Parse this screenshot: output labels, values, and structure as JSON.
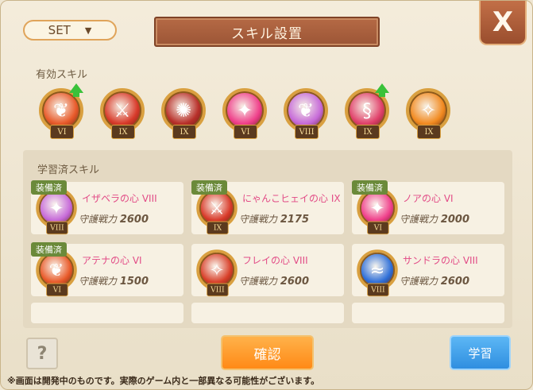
{
  "header": {
    "set_button_label": "SET",
    "set_dropdown_icon": "triangle-down",
    "title": "スキル設置",
    "close_label": "X"
  },
  "active_skills": {
    "label": "有効スキル",
    "items": [
      {
        "icon": "butterfly",
        "rank": "VI",
        "upgrade": true,
        "color": "#e85a2a"
      },
      {
        "icon": "sword",
        "rank": "IX",
        "upgrade": false,
        "color": "#d83a2a"
      },
      {
        "icon": "flame-beast",
        "rank": "IX",
        "upgrade": false,
        "color": "#b8302a"
      },
      {
        "icon": "sparkle",
        "rank": "VI",
        "upgrade": false,
        "color": "#ef3f8a"
      },
      {
        "icon": "butterfly",
        "rank": "VIII",
        "upgrade": false,
        "color": "#c66ad8"
      },
      {
        "icon": "serpent",
        "rank": "IX",
        "upgrade": true,
        "color": "#e0406a"
      },
      {
        "icon": "flame-sword",
        "rank": "IX",
        "upgrade": false,
        "color": "#f28a20"
      }
    ]
  },
  "learned_skills": {
    "label": "学習済スキル",
    "equipped_label": "装備済",
    "cards": [
      {
        "name": "イザベラの心 VIII",
        "power_label": "守護戦力",
        "power": "2600",
        "rank": "VIII",
        "equipped": true,
        "icon": "sparkle",
        "color": "#c66ad8"
      },
      {
        "name": "にゃんこヒェイの心 IX",
        "power_label": "守護戦力",
        "power": "2175",
        "rank": "IX",
        "equipped": true,
        "icon": "sword",
        "color": "#d83a2a"
      },
      {
        "name": "ノアの心 VI",
        "power_label": "守護戦力",
        "power": "2000",
        "rank": "VI",
        "equipped": true,
        "icon": "sparkle",
        "color": "#ef3f8a"
      },
      {
        "name": "アテナの心 VI",
        "power_label": "守護戦力",
        "power": "1500",
        "rank": "VI",
        "equipped": true,
        "icon": "butterfly",
        "color": "#e85a2a"
      },
      {
        "name": "フレイの心 VIII",
        "power_label": "守護戦力",
        "power": "2600",
        "rank": "VIII",
        "equipped": false,
        "icon": "flame-sword",
        "color": "#d8402a"
      },
      {
        "name": "サンドラの心 VIII",
        "power_label": "守護戦力",
        "power": "2600",
        "rank": "VIII",
        "equipped": false,
        "icon": "wave",
        "color": "#2f6fd8"
      }
    ]
  },
  "footer": {
    "help_label": "?",
    "confirm_label": "確認",
    "learn_label": "学習",
    "disclaimer": "※画面は開発中のものです。実際のゲーム内と一部異なる可能性がございます。"
  },
  "colors": {
    "confirm": "#ff8a16",
    "learn": "#2f8ee0",
    "skill_name": "#e24b86",
    "equipped_badge": "#6b8a3a"
  }
}
